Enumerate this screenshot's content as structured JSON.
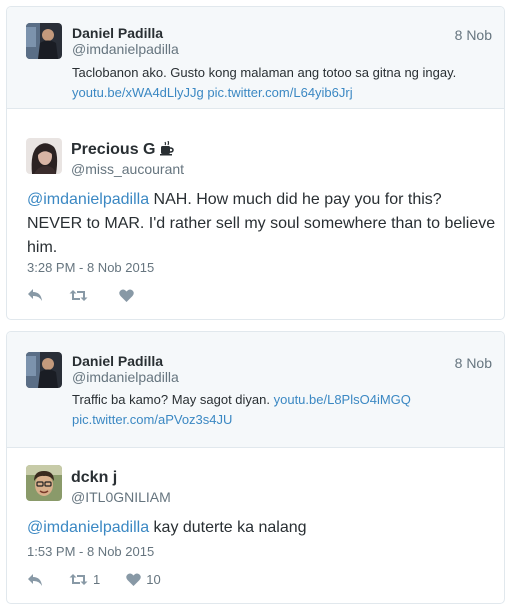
{
  "tweets": [
    {
      "quoted": {
        "name": "Daniel Padilla",
        "handle": "@imdanielpadilla",
        "date": "8 Nob",
        "text": "Taclobanon ako. Gusto kong malaman ang totoo sa gitna ng ingay. ",
        "links": [
          "youtu.be/xWA4dLlyJJg",
          "pic.twitter.com/L64yib6Jrj"
        ]
      },
      "author": {
        "name": "Precious G",
        "emoji": "coffee-emoji",
        "handle": "@miss_aucourant"
      },
      "mention": "@imdanielpadilla",
      "text": " NAH. How much did he pay you for this? NEVER to MAR. I'd rather sell my soul somewhere than to believe him.",
      "timestamp": "3:28 PM - 8 Nob 2015",
      "actions": {
        "retweets": "",
        "likes": ""
      }
    },
    {
      "quoted": {
        "name": "Daniel Padilla",
        "handle": "@imdanielpadilla",
        "date": "8 Nob",
        "text": "Traffic ba kamo? May sagot diyan. ",
        "links": [
          "youtu.be/L8PlsO4iMGQ",
          "pic.twitter.com/aPVoz3s4JU"
        ]
      },
      "author": {
        "name": "dckn j",
        "handle": "@ITL0GNILIAM"
      },
      "mention": "@imdanielpadilla",
      "text": " kay duterte ka nalang",
      "timestamp": "1:53 PM - 8 Nob 2015",
      "actions": {
        "retweets": "1",
        "likes": "10"
      }
    }
  ],
  "colors": {
    "link": "#3b88c3",
    "text": "#292f33",
    "muted": "#66757f",
    "icon": "#8899a6",
    "border": "#e1e8ed",
    "quoted_bg": "#f5f8fa"
  },
  "icons": [
    "reply-icon",
    "retweet-icon",
    "like-icon"
  ]
}
